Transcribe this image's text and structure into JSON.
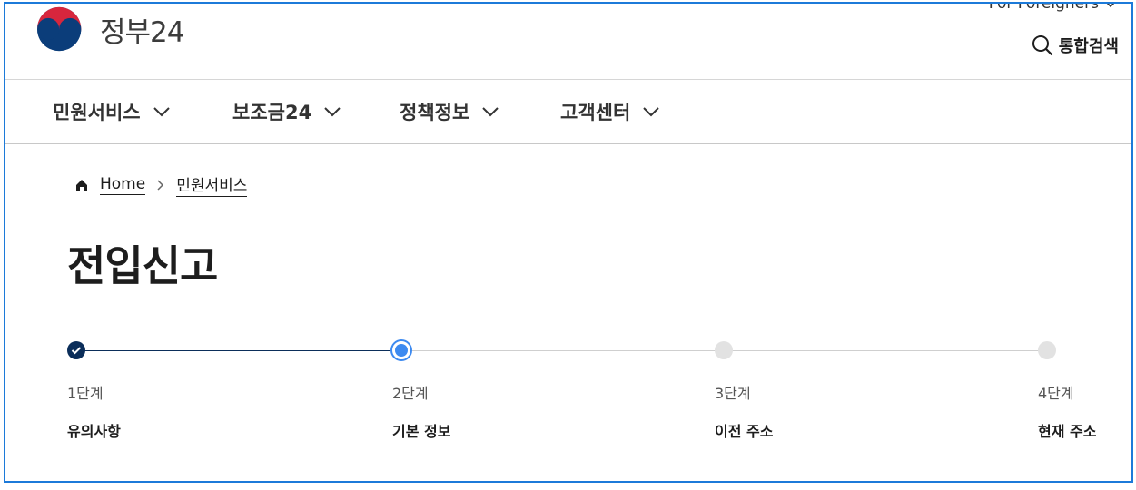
{
  "header": {
    "logo_text": "정부24",
    "for_foreigners": "For Foreigners",
    "search_label": "통합검색"
  },
  "nav": {
    "items": [
      {
        "label": "민원서비스"
      },
      {
        "label": "보조금24"
      },
      {
        "label": "정책정보"
      },
      {
        "label": "고객센터"
      }
    ]
  },
  "breadcrumb": {
    "home": "Home",
    "current": "민원서비스"
  },
  "page": {
    "title": "전입신고"
  },
  "steps": [
    {
      "number": "1단계",
      "label": "유의사항",
      "status": "done"
    },
    {
      "number": "2단계",
      "label": "기본 정보",
      "status": "current"
    },
    {
      "number": "3단계",
      "label": "이전 주소",
      "status": "todo"
    },
    {
      "number": "4단계",
      "label": "현재 주소",
      "status": "todo"
    }
  ],
  "colors": {
    "accent_border": "#1c7ad9",
    "step_done": "#0b2e5a",
    "step_current": "#3d8af0",
    "step_todo": "#e2e2e2"
  }
}
